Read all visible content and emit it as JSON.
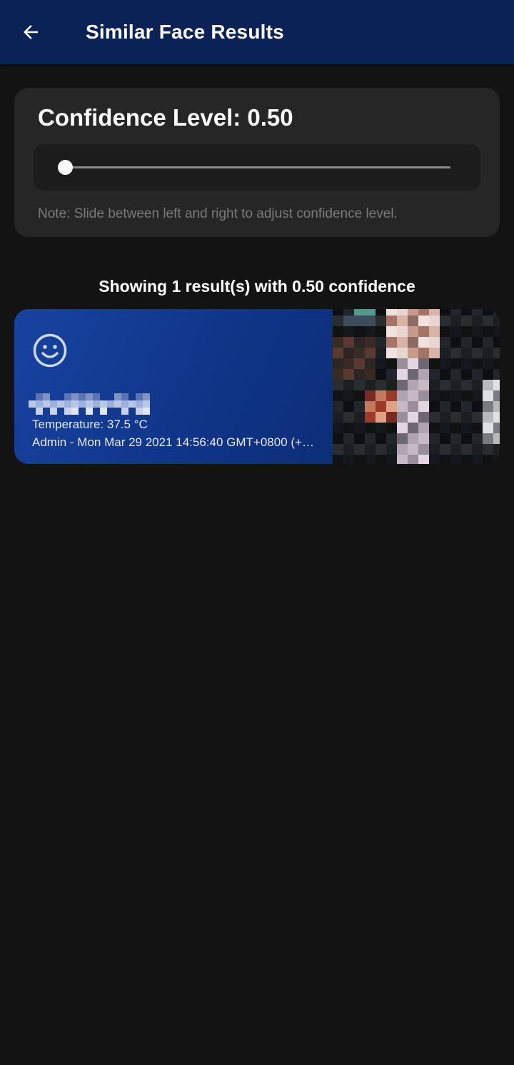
{
  "app_bar": {
    "title": "Similar Face Results",
    "back_icon": "arrow-back-icon",
    "background": "#0b2257"
  },
  "confidence": {
    "title": "Confidence Level: 0.50",
    "value": 0.5,
    "slider_min": 0.5,
    "slider_max": 1.0,
    "note": "Note: Slide between left and right to adjust confidence level."
  },
  "results": {
    "summary": "Showing 1 result(s) with 0.50 confidence",
    "items": [
      {
        "icon": "smiley-face-icon",
        "name_redacted": true,
        "temperature": "Temperature: 37.5 °C",
        "meta": "Admin - Mon Mar 29 2021 14:56:40 GMT+0800 (+…"
      }
    ]
  },
  "colors": {
    "page_background": "#131313",
    "card_background": "#262626",
    "result_card_gradient_start": "#1743a0",
    "result_card_gradient_end": "#0a2566"
  }
}
